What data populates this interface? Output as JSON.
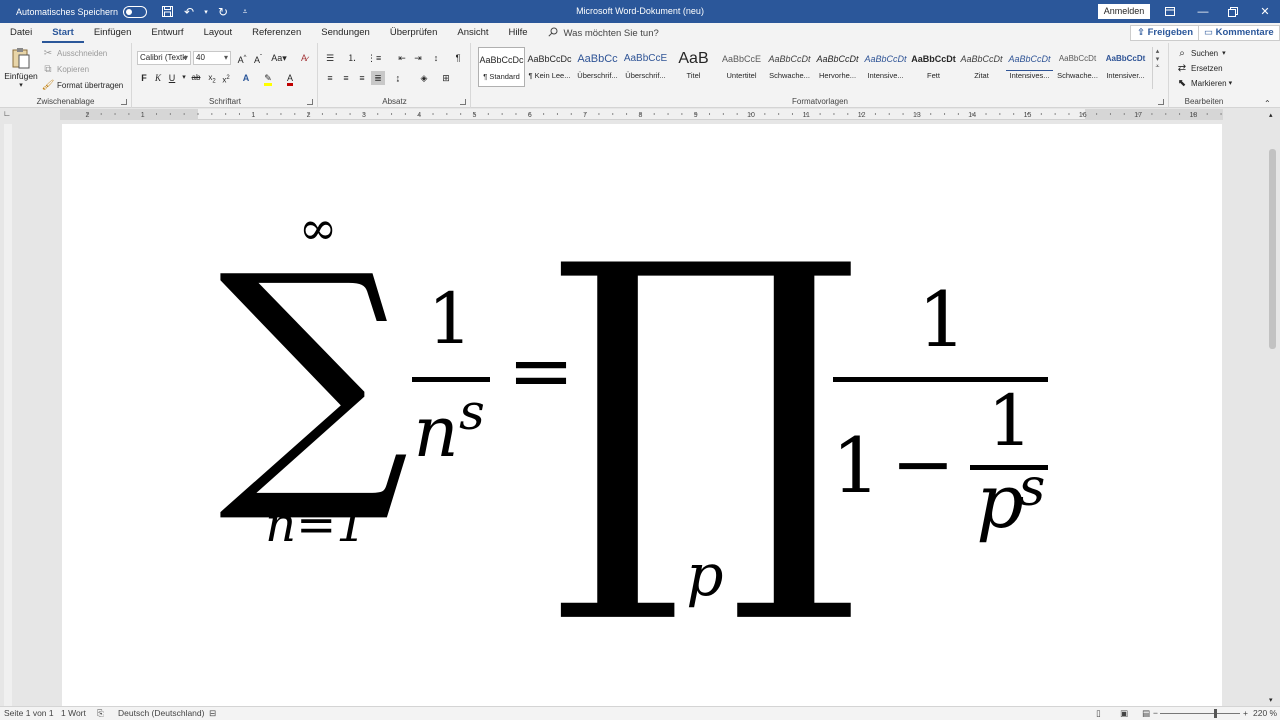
{
  "titlebar": {
    "autosave_label": "Automatisches Speichern",
    "doc_title": "Microsoft Word-Dokument (neu)",
    "signin_label": "Anmelden"
  },
  "tabs": [
    "Datei",
    "Start",
    "Einfügen",
    "Entwurf",
    "Layout",
    "Referenzen",
    "Sendungen",
    "Überprüfen",
    "Ansicht",
    "Hilfe"
  ],
  "active_tab": "Start",
  "tellme_placeholder": "Was möchten Sie tun?",
  "share_label": "Freigeben",
  "comments_label": "Kommentare",
  "clipboard": {
    "paste": "Einfügen",
    "cut": "Ausschneiden",
    "copy": "Kopieren",
    "format_painter": "Format übertragen",
    "label": "Zwischenablage"
  },
  "font": {
    "name": "Calibri (Textk",
    "size": "40",
    "label": "Schriftart"
  },
  "paragraph_label": "Absatz",
  "styles": {
    "label": "Formatvorlagen",
    "items": [
      {
        "sample": "AaBbCcDc",
        "name": "¶ Standard"
      },
      {
        "sample": "AaBbCcDc",
        "name": "¶ Kein Lee..."
      },
      {
        "sample": "AaBbCc",
        "name": "Überschrif..."
      },
      {
        "sample": "AaBbCcE",
        "name": "Überschrif..."
      },
      {
        "sample": "AaB",
        "name": "Titel"
      },
      {
        "sample": "AaBbCcE",
        "name": "Untertitel"
      },
      {
        "sample": "AaBbCcDt",
        "name": "Schwache..."
      },
      {
        "sample": "AaBbCcDt",
        "name": "Hervorhe..."
      },
      {
        "sample": "AaBbCcDt",
        "name": "Intensive..."
      },
      {
        "sample": "AaBbCcDt",
        "name": "Fett"
      },
      {
        "sample": "AaBbCcDt",
        "name": "Zitat"
      },
      {
        "sample": "AaBbCcDt",
        "name": "Intensives..."
      },
      {
        "sample": "AaBbCcDt",
        "name": "Schwache..."
      },
      {
        "sample": "AaBbCcDt",
        "name": "Intensiver..."
      }
    ]
  },
  "editing": {
    "find": "Suchen",
    "replace": "Ersetzen",
    "select": "Markieren",
    "label": "Bearbeiten"
  },
  "ruler_numbers": [
    "2",
    "1",
    "1",
    "2",
    "3",
    "4",
    "5",
    "6",
    "7",
    "8",
    "9",
    "10",
    "11",
    "12",
    "13",
    "14",
    "15",
    "16",
    "17",
    "18"
  ],
  "equation": {
    "sum_upper": "∞",
    "sum_symbol": "∑",
    "sum_lower": "n=1",
    "lhs_num": "1",
    "lhs_den_base": "n",
    "lhs_den_exp": "s",
    "equals": "=",
    "prod_symbol": "∏",
    "prod_lower": "p",
    "rhs_num": "1",
    "rhs_den_one": "1",
    "rhs_den_minus": "−",
    "rhs_inner_num": "1",
    "rhs_inner_den_base": "p",
    "rhs_inner_den_exp": "s"
  },
  "status": {
    "page": "Seite 1 von 1",
    "words": "1 Wort",
    "language": "Deutsch (Deutschland)",
    "zoom": "220 %"
  }
}
